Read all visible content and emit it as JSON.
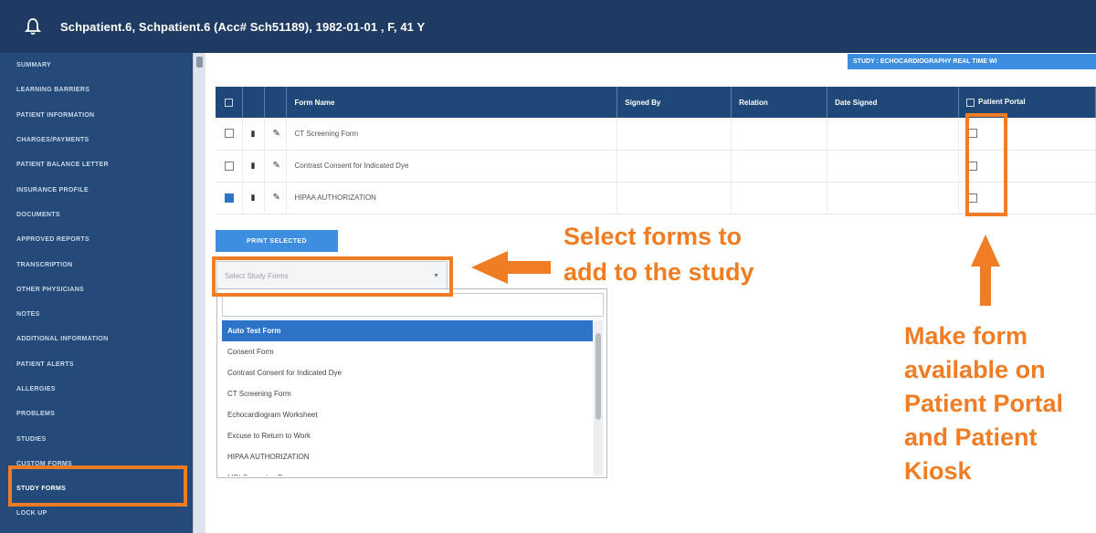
{
  "header": {
    "patient_title": "Schpatient.6, Schpatient.6 (Acc# Sch51189), 1982-01-01 , F, 41 Y",
    "bell_icon": "bell-icon"
  },
  "sidebar": {
    "items": [
      {
        "label": "Summary"
      },
      {
        "label": "Learning Barriers"
      },
      {
        "label": "Patient Information"
      },
      {
        "label": "Charges/Payments"
      },
      {
        "label": "Patient Balance Letter"
      },
      {
        "label": "Insurance Profile"
      },
      {
        "label": "Documents"
      },
      {
        "label": "Approved Reports"
      },
      {
        "label": "Transcription"
      },
      {
        "label": "Other Physicians"
      },
      {
        "label": "Notes"
      },
      {
        "label": "Additional Information"
      },
      {
        "label": "Patient Alerts"
      },
      {
        "label": "Allergies"
      },
      {
        "label": "Problems"
      },
      {
        "label": "Studies"
      },
      {
        "label": "Custom Forms"
      },
      {
        "label": "Study Forms"
      },
      {
        "label": "Lock Up"
      }
    ]
  },
  "study_badge": "STUDY : ECHOCARDIOGRAPHY REAL TIME WI",
  "table": {
    "headers": {
      "form_name": "Form Name",
      "signed_by": "Signed By",
      "relation": "Relation",
      "date_signed": "Date Signed",
      "patient_portal": "Patient Portal"
    },
    "rows": [
      {
        "checked": false,
        "form_name": "CT Screening Form",
        "signed_by": "",
        "relation": "",
        "date_signed": "",
        "portal": false
      },
      {
        "checked": false,
        "form_name": "Contrast Consent for Indicated Dye",
        "signed_by": "",
        "relation": "",
        "date_signed": "",
        "portal": false
      },
      {
        "checked": true,
        "form_name": "HIPAA AUTHORIZATION",
        "signed_by": "",
        "relation": "",
        "date_signed": "",
        "portal": false
      }
    ]
  },
  "print_button": "PRINT SELECTED",
  "select": {
    "placeholder": "Select Study Forms"
  },
  "dropdown": {
    "options": [
      {
        "label": "Auto Test Form",
        "highlighted": true
      },
      {
        "label": "Consent Form",
        "highlighted": false
      },
      {
        "label": "Contrast Consent for Indicated Dye",
        "highlighted": false
      },
      {
        "label": "CT Screening Form",
        "highlighted": false
      },
      {
        "label": "Echocardiogram Worksheet",
        "highlighted": false
      },
      {
        "label": "Excuse to Return to Work",
        "highlighted": false
      },
      {
        "label": "HIPAA AUTHORIZATION",
        "highlighted": false
      },
      {
        "label": "MRI Screening Form",
        "highlighted": false
      }
    ]
  },
  "annotations": {
    "left_line1": "Select forms to",
    "left_line2": "add to the study",
    "right_line1": "Make form",
    "right_line2": "available on",
    "right_line3": "Patient Portal",
    "right_line4": "and Patient",
    "right_line5": "Kiosk",
    "color": "#f07d23"
  }
}
